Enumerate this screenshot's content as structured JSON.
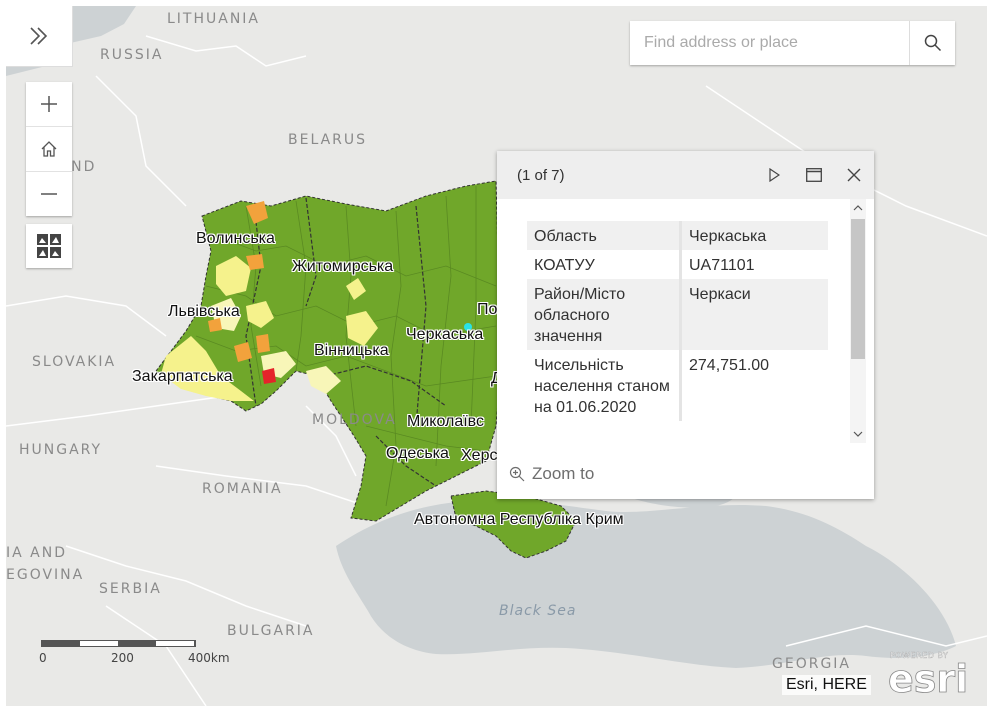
{
  "search": {
    "placeholder": "Find address or place"
  },
  "map": {
    "colors": {
      "land": "#e9e9e7",
      "water": "#cdd2d4",
      "border": "#ffffff",
      "ukraine_green": "#70a72a",
      "yellow": "#f5f28c",
      "light_yellow": "#f8f6b8",
      "orange": "#f2a23c",
      "red": "#e5242a",
      "cyan": "#29e2e6"
    },
    "country_labels": [
      {
        "id": "lithuania",
        "text": "LITHUANIA"
      },
      {
        "id": "russia",
        "text": "RUSSIA"
      },
      {
        "id": "belarus",
        "text": "BELARUS"
      },
      {
        "id": "poland",
        "text": "POLAND"
      },
      {
        "id": "slovakia",
        "text": "SLOVAKIA"
      },
      {
        "id": "hungary",
        "text": "HUNGARY"
      },
      {
        "id": "moldova",
        "text": "MOLDOVA"
      },
      {
        "id": "romania",
        "text": "ROMANIA"
      },
      {
        "id": "bosnia1",
        "text": "IA AND"
      },
      {
        "id": "bosnia2",
        "text": "EGOVINA"
      },
      {
        "id": "serbia",
        "text": "SERBIA"
      },
      {
        "id": "bulgaria",
        "text": "BULGARIA"
      },
      {
        "id": "georgia",
        "text": "GEORGIA"
      }
    ],
    "sea_label": "Black Sea",
    "oblast_labels": [
      {
        "id": "volyn",
        "text": "Волинська"
      },
      {
        "id": "zhytomyr",
        "text": "Житомирська"
      },
      {
        "id": "lviv",
        "text": "Львівська"
      },
      {
        "id": "cherkasy",
        "text": "Черкаська"
      },
      {
        "id": "vinnytsia",
        "text": "Вінницька"
      },
      {
        "id": "zakarpattia",
        "text": "Закарпатська"
      },
      {
        "id": "mykolaiv",
        "text": "Миколаївс"
      },
      {
        "id": "odesa",
        "text": "Одеська"
      },
      {
        "id": "kherson",
        "text": "Херс"
      },
      {
        "id": "crimea",
        "text": "Автономна Республіка Крим"
      },
      {
        "id": "poltava_partial",
        "text": "По"
      },
      {
        "id": "dnipro_partial",
        "text": "Д"
      }
    ]
  },
  "popup": {
    "count": "(1 of 7)",
    "rows": [
      {
        "key": "Область",
        "value": "Черкаська"
      },
      {
        "key": "КОАТУУ",
        "value": "UA71101"
      },
      {
        "key": "Район/Місто обласного значення",
        "value": "Черкаси"
      },
      {
        "key": "Чисельність населення станом на 01.06.2020",
        "value": "274,751.00"
      }
    ],
    "zoom_to": "Zoom to"
  },
  "scalebar": {
    "labels": [
      "0",
      "200",
      "400km"
    ]
  },
  "attribution": "Esri, HERE",
  "logo": {
    "top": "POWERED BY",
    "brand": "esri"
  }
}
